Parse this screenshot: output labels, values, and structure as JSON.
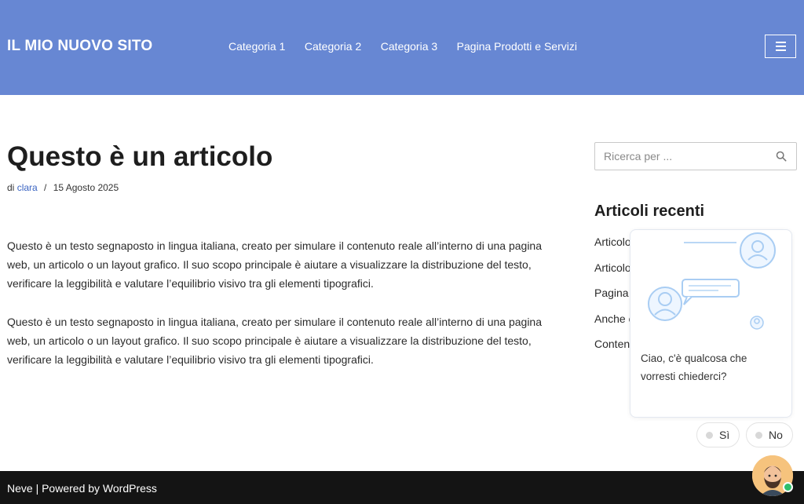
{
  "header": {
    "site_title": "IL MIO NUOVO SITO",
    "nav": [
      "Categoria 1",
      "Categoria 2",
      "Categoria 3",
      "Pagina Prodotti e Servizi"
    ]
  },
  "post": {
    "title": "Questo è un articolo",
    "meta_prefix": "di",
    "author": "clara",
    "meta_separator": "/",
    "date": "15 Agosto 2025",
    "paragraphs": [
      "Questo è un testo segnaposto in lingua italiana, creato per simulare il contenuto reale all’interno di una pagina web, un articolo o un layout grafico. Il suo scopo principale è aiutare a visualizzare la distribuzione del testo, verificare la leggibilità e valutare l’equilibrio visivo tra gli elementi tipografici.",
      "Questo è un testo segnaposto in lingua italiana, creato per simulare il contenuto reale all’interno di una pagina web, un articolo o un layout grafico. Il suo scopo principale è aiutare a visualizzare la distribuzione del testo, verificare la leggibilità e valutare l’equilibrio visivo tra gli elementi tipografici."
    ]
  },
  "sidebar": {
    "search_placeholder": "Ricerca per ...",
    "widget_title": "Articoli recenti",
    "recent_items": [
      "Articolo",
      "Articolo",
      "Pagina",
      "Anche c",
      "Conten"
    ]
  },
  "chat": {
    "message": "Ciao, c'è qualcosa che vorresti chiederci?",
    "reply_yes": "Sì",
    "reply_no": "No"
  },
  "footer": {
    "text": "Neve | Powered by WordPress"
  },
  "colors": {
    "header_bg": "#6787d3",
    "footer_bg": "#141414",
    "link": "#3a64c2",
    "online": "#2fbf6b"
  }
}
